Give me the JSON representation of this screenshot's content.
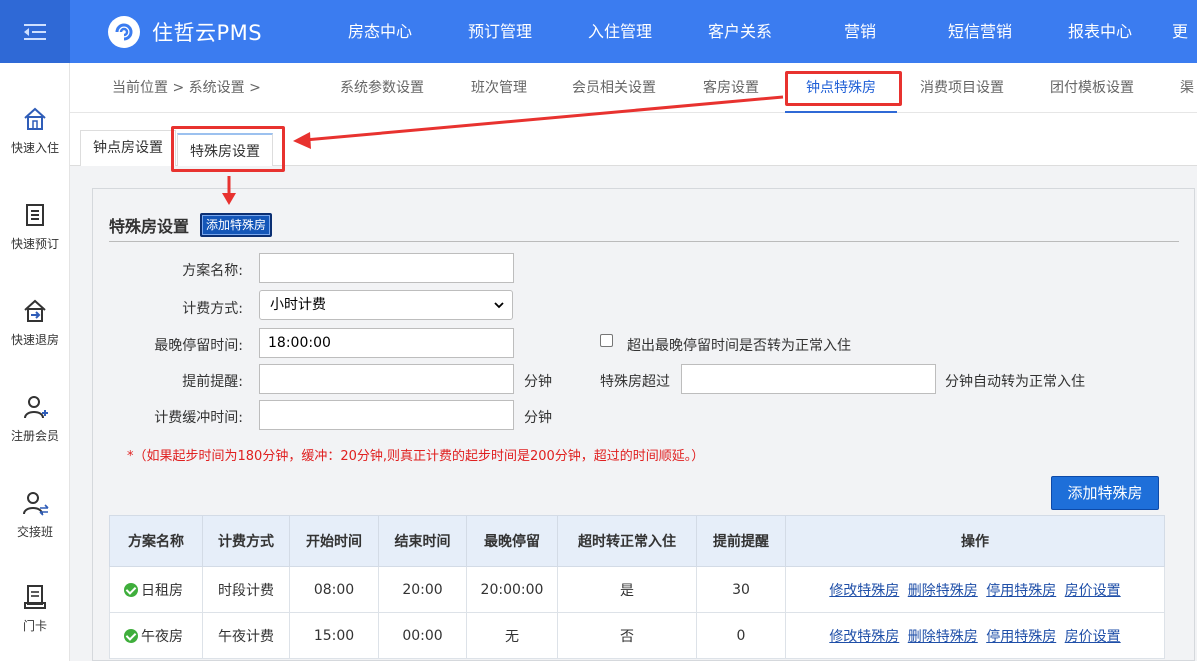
{
  "header": {
    "logo_text": "住哲云PMS",
    "nav": [
      "房态中心",
      "预订管理",
      "入住管理",
      "客户关系",
      "营销",
      "短信营销",
      "报表中心",
      "更"
    ]
  },
  "sidebar": {
    "items": [
      {
        "label": "快速入住",
        "icon": "home-icon"
      },
      {
        "label": "快速预订",
        "icon": "booking-list-icon"
      },
      {
        "label": "快速退房",
        "icon": "checkout-icon"
      },
      {
        "label": "注册会员",
        "icon": "add-user-icon"
      },
      {
        "label": "交接班",
        "icon": "shift-handover-icon"
      },
      {
        "label": "门卡",
        "icon": "door-card-icon"
      }
    ]
  },
  "breadcrumb": {
    "text": "当前位置  >  系统设置  >"
  },
  "subtabs": [
    "系统参数设置",
    "班次管理",
    "会员相关设置",
    "客房设置",
    "钟点特殊房",
    "消费项目设置",
    "团付模板设置",
    "渠"
  ],
  "inner_tabs": [
    "钟点房设置",
    "特殊房设置"
  ],
  "form": {
    "title": "特殊房设置",
    "add_small_label": "添加特殊房",
    "scheme_name_label": "方案名称:",
    "scheme_name_value": "",
    "billing_label": "计费方式:",
    "billing_value": "小时计费",
    "latest_stay_label": "最晚停留时间:",
    "latest_stay_value": "18:00:00",
    "overtime_checkbox_label": "超出最晚停留时间是否转为正常入住",
    "remind_label": "提前提醒:",
    "remind_value": "",
    "minute_unit": "分钟",
    "special_over_label": "特殊房超过",
    "special_over_value": "",
    "special_over_suffix": "分钟自动转为正常入住",
    "buffer_label": "计费缓冲时间:",
    "buffer_value": "",
    "note": "*（如果起步时间为180分钟，缓冲：20分钟,则真正计费的起步时间是200分钟，超过的时间顺延。）",
    "add_big_label": "添加特殊房"
  },
  "table": {
    "headers": [
      "方案名称",
      "计费方式",
      "开始时间",
      "结束时间",
      "最晚停留",
      "超时转正常入住",
      "提前提醒",
      "操作"
    ],
    "rows": [
      {
        "name": "日租房",
        "billing": "时段计费",
        "start": "08:00",
        "end": "20:00",
        "latest": "20:00:00",
        "overtime": "是",
        "remind": "30"
      },
      {
        "name": "午夜房",
        "billing": "午夜计费",
        "start": "15:00",
        "end": "00:00",
        "latest": "无",
        "overtime": "否",
        "remind": "0"
      }
    ],
    "actions": [
      "修改特殊房",
      "删除特殊房",
      "停用特殊房",
      "房价设置"
    ]
  },
  "colors": {
    "primary": "#3b7cf0",
    "highlight": "#e8322f",
    "note_red": "#e02020"
  }
}
